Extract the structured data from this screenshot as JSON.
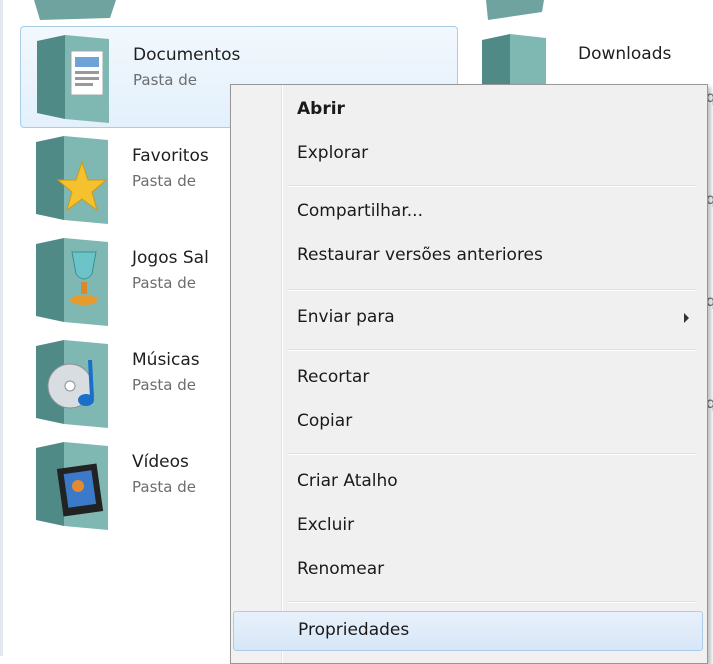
{
  "explorer": {
    "items": [
      {
        "name": "Documentos",
        "sub": "Pasta de",
        "icon": "documents-folder-icon"
      },
      {
        "name": "Favoritos",
        "sub": "Pasta de",
        "icon": "favorites-folder-icon"
      },
      {
        "name": "Jogos Sal",
        "sub": "Pasta de",
        "icon": "saved-games-folder-icon"
      },
      {
        "name": "Músicas",
        "sub": "Pasta de",
        "icon": "music-folder-icon"
      },
      {
        "name": "Vídeos",
        "sub": "Pasta de",
        "icon": "videos-folder-icon"
      }
    ],
    "right_item": {
      "name": "Downloads",
      "icon": "downloads-folder-icon"
    },
    "right_edge_fragments": [
      "q",
      "q",
      "q",
      "q"
    ]
  },
  "context_menu": {
    "items": [
      {
        "label": "Abrir",
        "bold": true
      },
      {
        "label": "Explorar"
      },
      {
        "label": "Compartilhar..."
      },
      {
        "label": "Restaurar versões anteriores"
      },
      {
        "label": "Enviar para",
        "submenu": true
      },
      {
        "label": "Recortar"
      },
      {
        "label": "Copiar"
      },
      {
        "label": "Criar Atalho"
      },
      {
        "label": "Excluir"
      },
      {
        "label": "Renomear"
      },
      {
        "label": "Propriedades",
        "hovered": true
      }
    ]
  },
  "colors": {
    "selection_border": "#a8cde8",
    "menu_background": "#f0f0f0",
    "hover_border": "#aecbe9"
  }
}
